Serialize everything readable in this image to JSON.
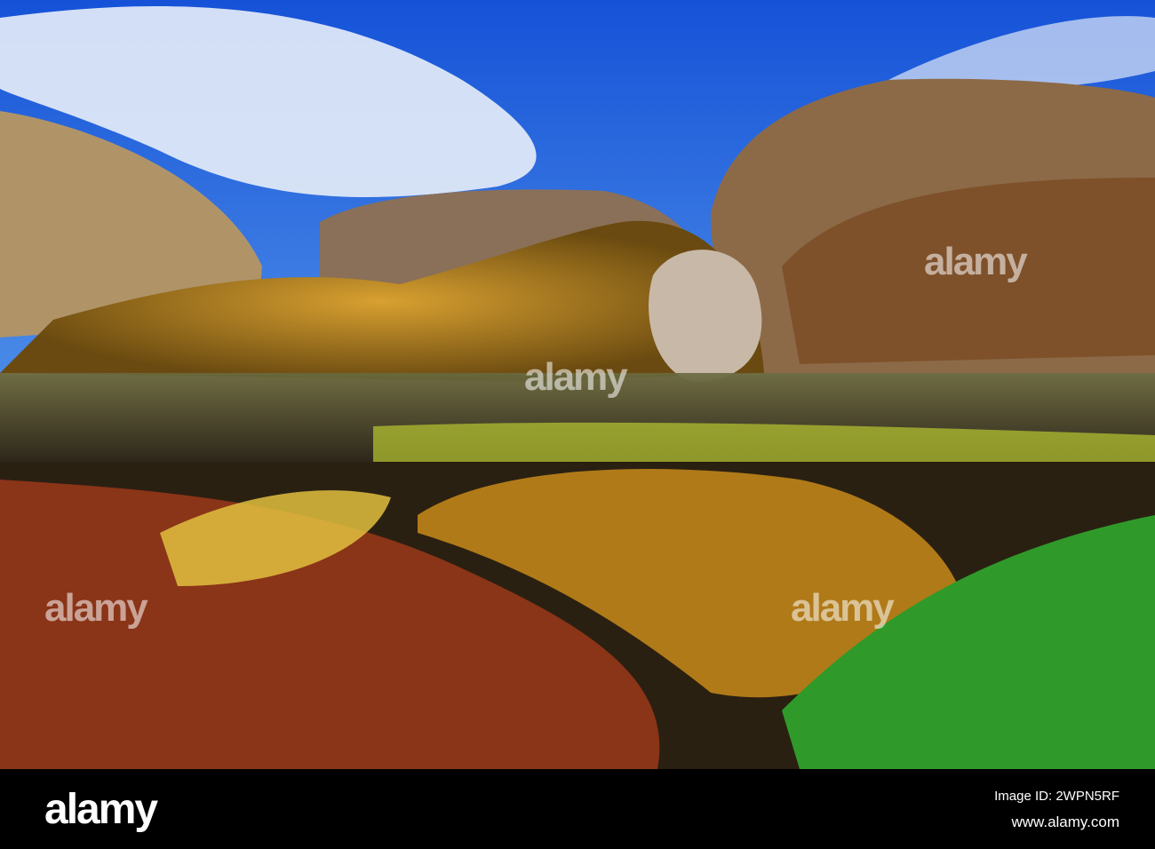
{
  "watermark": {
    "brand": "alamy"
  },
  "footer": {
    "logo": "alamy",
    "image_id": "Image ID: 2WPN5RF",
    "website": "www.alamy.com"
  }
}
